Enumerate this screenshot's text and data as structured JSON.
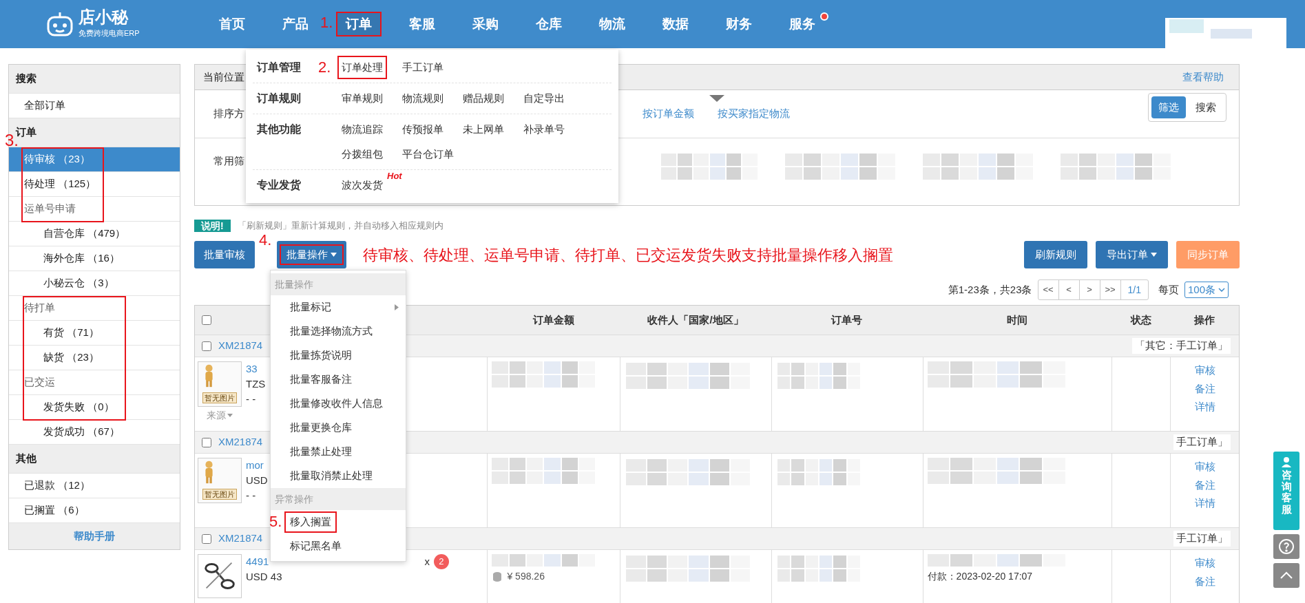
{
  "nav": {
    "logo_text": "店小秘",
    "logo_subtitle": "免费跨境电商ERP",
    "items": [
      {
        "label": "首页",
        "selected": false,
        "dot": false
      },
      {
        "label": "产品",
        "selected": false,
        "dot": false
      },
      {
        "label": "订单",
        "selected": true,
        "dot": false,
        "annotation": "1."
      },
      {
        "label": "客服",
        "selected": false,
        "dot": false
      },
      {
        "label": "采购",
        "selected": false,
        "dot": false
      },
      {
        "label": "仓库",
        "selected": false,
        "dot": false
      },
      {
        "label": "物流",
        "selected": false,
        "dot": false
      },
      {
        "label": "数据",
        "selected": false,
        "dot": false
      },
      {
        "label": "财务",
        "selected": false,
        "dot": false
      },
      {
        "label": "服务",
        "selected": false,
        "dot": true
      }
    ]
  },
  "order_menu": {
    "groups": [
      {
        "title": "订单管理",
        "links": [
          {
            "label": "订单处理",
            "annotation": "2."
          },
          {
            "label": "手工订单"
          }
        ]
      },
      {
        "title": "订单规则",
        "links": [
          {
            "label": "审单规则"
          },
          {
            "label": "物流规则"
          },
          {
            "label": "赠品规则"
          },
          {
            "label": "自定导出"
          }
        ]
      },
      {
        "title": "其他功能",
        "links": [
          {
            "label": "物流追踪"
          },
          {
            "label": "传预报单"
          },
          {
            "label": "未上网单"
          },
          {
            "label": "补录单号"
          },
          {
            "label": "分拨组包"
          },
          {
            "label": "平台仓订单"
          }
        ]
      },
      {
        "title": "专业发货",
        "links": [
          {
            "label": "波次发货",
            "badge": "Hot"
          }
        ]
      }
    ]
  },
  "sidebar": {
    "sections": [
      {
        "title": "搜索",
        "items": [
          {
            "label": "全部订单",
            "selected": false
          }
        ]
      },
      {
        "title": "订单",
        "annotation": "3.",
        "items": [
          {
            "label": "待审核",
            "count": "（23）",
            "selected": true
          },
          {
            "label": "待处理",
            "count": "（125）",
            "selected": false
          },
          {
            "label": "运单号申请",
            "selected": false,
            "children": [
              {
                "label": "自营仓库",
                "count": "（479）",
                "selected": false
              },
              {
                "label": "海外仓库",
                "count": "（16）",
                "selected": false
              },
              {
                "label": "小秘云仓",
                "count": "（3）",
                "selected": false
              }
            ]
          },
          {
            "label": "待打单",
            "selected": false,
            "children": [
              {
                "label": "有货",
                "count": "（71）",
                "selected": false
              },
              {
                "label": "缺货",
                "count": "（23）",
                "selected": false
              }
            ]
          },
          {
            "label": "已交运",
            "selected": false,
            "children": [
              {
                "label": "发货失败",
                "count": "（0）",
                "selected": false
              },
              {
                "label": "发货成功",
                "count": "（67）",
                "selected": false
              }
            ]
          }
        ]
      },
      {
        "title": "其他",
        "items": [
          {
            "label": "已退款",
            "count": "（12）",
            "selected": false
          },
          {
            "label": "已搁置",
            "count": "（6）",
            "selected": false
          }
        ]
      }
    ],
    "help_link": "帮助手册"
  },
  "location": {
    "label": "当前位置",
    "help": "查看帮助"
  },
  "filters": {
    "sort_label": "排序方",
    "sort_options": [
      {
        "label": "按订单金额",
        "selected": false
      },
      {
        "label": "按买家指定物流",
        "selected": false
      }
    ],
    "common_label": "常用筛",
    "modes": [
      {
        "label": "筛选",
        "selected": true
      },
      {
        "label": "搜索",
        "selected": false
      }
    ]
  },
  "notice": {
    "badge": "说明!",
    "text": "「刷新规则」重新计算规则，并自动移入相应规则内"
  },
  "toolbar": {
    "left": [
      {
        "label": "批量审核",
        "dropdown": false
      },
      {
        "label": "批量操作",
        "dropdown": true,
        "annotation": "4."
      }
    ],
    "annotation_text": "待审核、待处理、运单号申请、待打单、已交运发货失败支持批量操作移入搁置",
    "right": [
      {
        "label": "刷新规则",
        "kind": "primary",
        "dropdown": false
      },
      {
        "label": "导出订单",
        "kind": "primary",
        "dropdown": true
      },
      {
        "label": "同步订单",
        "kind": "warning",
        "dropdown": false
      }
    ]
  },
  "batch_menu": {
    "sections": [
      {
        "title": "批量操作",
        "items": [
          {
            "label": "批量标记",
            "submenu": true
          },
          {
            "label": "批量选择物流方式",
            "submenu": false
          },
          {
            "label": "批量拣货说明",
            "submenu": false
          },
          {
            "label": "批量客服备注",
            "submenu": false
          },
          {
            "label": "批量修改收件人信息",
            "submenu": false
          },
          {
            "label": "批量更换仓库",
            "submenu": false
          },
          {
            "label": "批量禁止处理",
            "submenu": false
          },
          {
            "label": "批量取消禁止处理",
            "submenu": false
          }
        ]
      },
      {
        "title": "异常操作",
        "items": [
          {
            "label": "移入搁置",
            "submenu": false,
            "annotation": "5."
          },
          {
            "label": "标记黑名单",
            "submenu": false
          }
        ]
      }
    ]
  },
  "pagination": {
    "summary": "第1-23条，共23条",
    "buttons": [
      "<<",
      "<",
      ">",
      ">>"
    ],
    "page": "1/1",
    "per_page_label": "每页",
    "per_page": "100条"
  },
  "table": {
    "select_all_checked": false,
    "columns": [
      "订单金额",
      "收件人「国家/地区」",
      "订单号",
      "时间",
      "状态",
      "操作"
    ],
    "orders": [
      {
        "order_no": "XM21874",
        "checked": false,
        "tag": "「其它：手工订单」",
        "placeholder_text": "暂无图片",
        "title": "33",
        "lines": [
          "TZS",
          "- -"
        ],
        "source": "来源",
        "actions": [
          "审核",
          "备注",
          "详情"
        ]
      },
      {
        "order_no": "XM21874",
        "checked": false,
        "tag": "手工订单」",
        "placeholder_text": "暂无图片",
        "title": "mor",
        "lines": [
          "USD",
          "- -"
        ],
        "actions": [
          "审核",
          "备注",
          "详情"
        ]
      },
      {
        "order_no": "XM21874",
        "checked": false,
        "tag": "手工订单」",
        "title": "4491",
        "quantity_mark": "x",
        "quantity": "2",
        "lines": [
          "USD 43"
        ],
        "amount": "¥ 598.26",
        "time": "付款：2023-02-20 17:07",
        "actions": [
          "审核",
          "备注"
        ]
      }
    ]
  },
  "side_widgets": {
    "consult": "咨询客服"
  }
}
